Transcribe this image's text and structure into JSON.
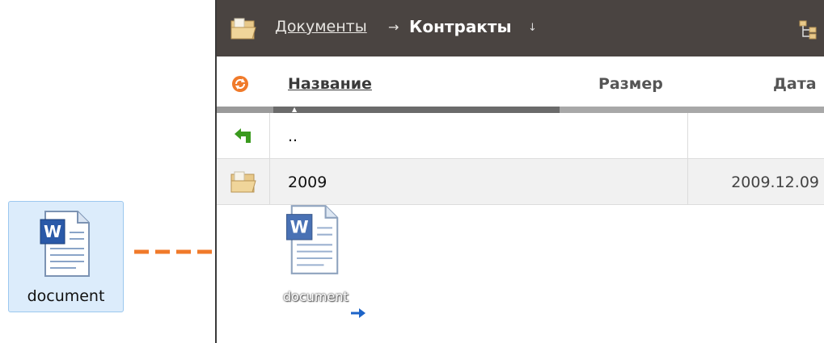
{
  "desktop": {
    "item_label": "document",
    "item_icon": "word-document-icon"
  },
  "breadcrumb": {
    "parent_label": "Документы",
    "separator": "→",
    "current_label": "Контракты",
    "dropdown_glyph": "↓"
  },
  "columns": {
    "name": "Название",
    "size": "Размер",
    "date": "Дата"
  },
  "rows": [
    {
      "name": "..",
      "date": "",
      "icon": "up-arrow-icon"
    },
    {
      "name": "2009",
      "date": "2009.12.09",
      "icon": "folder-icon"
    }
  ],
  "drag": {
    "ghost_label": "document"
  },
  "colors": {
    "toolbar_bg": "#4a4441",
    "drag_arrow": "#f07a2a",
    "selection_bg": "#dcecfb"
  }
}
